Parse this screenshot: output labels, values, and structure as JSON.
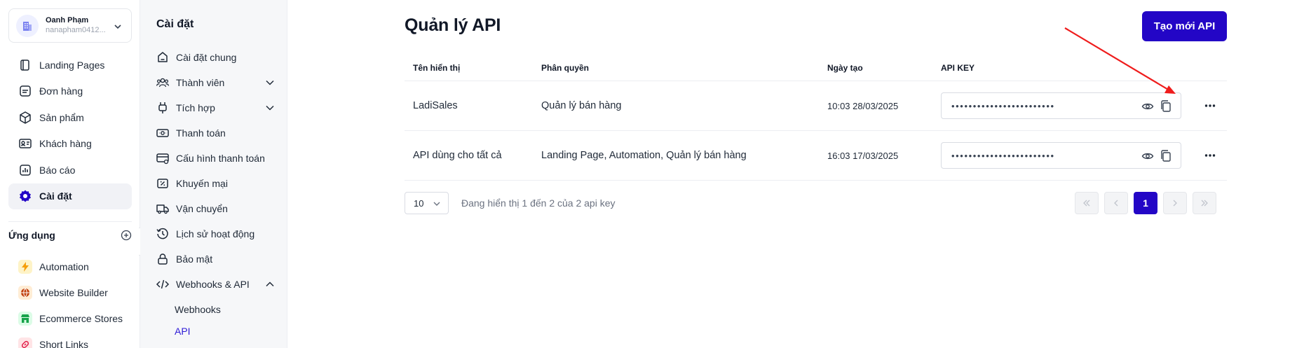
{
  "account": {
    "name": "Oanh Phạm",
    "email": "nanapham0412..."
  },
  "nav": {
    "items": [
      {
        "label": "Landing Pages",
        "icon": "landing-pages-icon"
      },
      {
        "label": "Đơn hàng",
        "icon": "orders-icon"
      },
      {
        "label": "Sản phẩm",
        "icon": "box-icon"
      },
      {
        "label": "Khách hàng",
        "icon": "customer-card-icon"
      },
      {
        "label": "Báo cáo",
        "icon": "report-chart-icon"
      },
      {
        "label": "Cài đặt",
        "icon": "gear-icon",
        "active": true
      }
    ]
  },
  "apps": {
    "title": "Ứng dụng",
    "items": [
      {
        "label": "Automation",
        "icon": "lightning-icon",
        "color": "#f59e0b"
      },
      {
        "label": "Website Builder",
        "icon": "globe-icon",
        "color": "#c2410c"
      },
      {
        "label": "Ecommerce Stores",
        "icon": "store-icon",
        "color": "#16a34a"
      },
      {
        "label": "Short Links",
        "icon": "link-icon",
        "color": "#e11d48"
      }
    ]
  },
  "settings": {
    "title": "Cài đặt",
    "items": [
      {
        "label": "Cài đặt chung",
        "icon": "home-icon"
      },
      {
        "label": "Thành viên",
        "icon": "members-icon",
        "expandable": true
      },
      {
        "label": "Tích hợp",
        "icon": "plug-icon",
        "expandable": true
      },
      {
        "label": "Thanh toán",
        "icon": "payment-icon"
      },
      {
        "label": "Cấu hình thanh toán",
        "icon": "payment-config-icon"
      },
      {
        "label": "Khuyến mại",
        "icon": "discount-icon"
      },
      {
        "label": "Vận chuyển",
        "icon": "truck-icon"
      },
      {
        "label": "Lịch sử hoạt động",
        "icon": "history-icon"
      },
      {
        "label": "Bảo mật",
        "icon": "lock-icon"
      },
      {
        "label": "Webhooks & API",
        "icon": "code-icon",
        "expanded": true
      }
    ],
    "sub_items": [
      {
        "label": "Webhooks"
      },
      {
        "label": "API",
        "active": true
      }
    ]
  },
  "main": {
    "title": "Quản lý API",
    "create_button": "Tạo mới API",
    "columns": [
      "Tên hiển thị",
      "Phân quyền",
      "Ngày tạo",
      "API KEY"
    ],
    "rows": [
      {
        "name": "LadiSales",
        "permission": "Quản lý bán hàng",
        "created": "10:03 28/03/2025",
        "key": "••••••••••••••••••••••••"
      },
      {
        "name": "API dùng cho tất cả",
        "permission": "Landing Page, Automation, Quản lý bán hàng",
        "created": "16:03 17/03/2025",
        "key": "••••••••••••••••••••••••"
      }
    ],
    "page_size": "10",
    "showing_text": "Đang hiển thị 1 đến 2 của 2 api key",
    "current_page": "1"
  },
  "colors": {
    "accent": "#2306c6",
    "annotation": "#ef1c1c"
  }
}
